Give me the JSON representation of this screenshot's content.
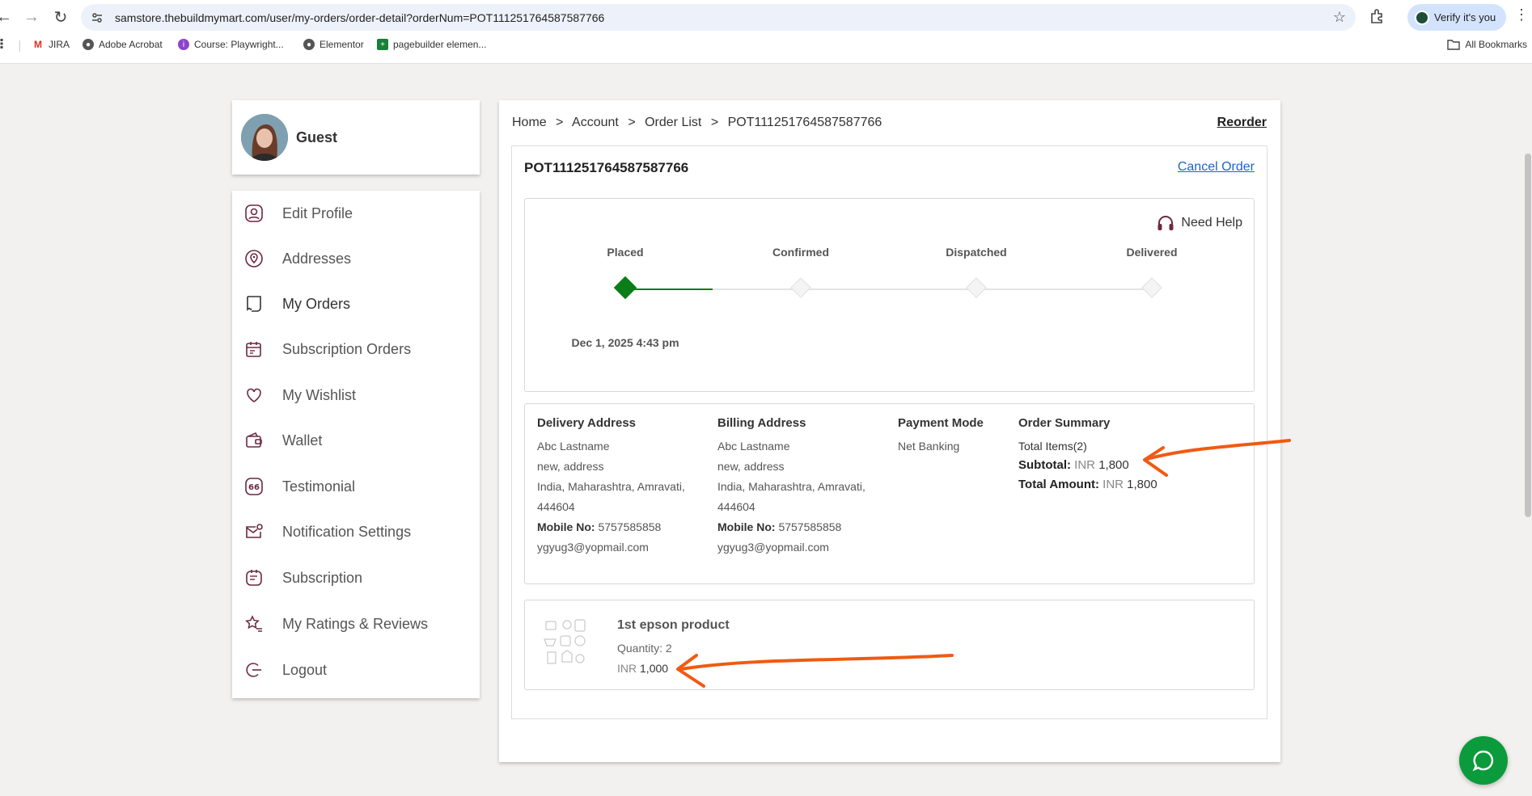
{
  "browser": {
    "url": "samstore.thebuildmymart.com/user/my-orders/order-detail?orderNum=POT111251764587587766",
    "profile_label": "Verify it's you",
    "bookmarks": [
      {
        "label": "JIRA",
        "icon": "gmail-icon"
      },
      {
        "label": "Adobe Acrobat",
        "icon": "globe-icon"
      },
      {
        "label": "Course: Playwright...",
        "icon": "course-icon"
      },
      {
        "label": "Elementor",
        "icon": "globe-icon"
      },
      {
        "label": "pagebuilder elemen...",
        "icon": "sheets-icon"
      }
    ],
    "all_bookmarks": "All Bookmarks"
  },
  "profile": {
    "name": "Guest"
  },
  "menu": [
    {
      "label": "Edit Profile",
      "icon": "user-icon"
    },
    {
      "label": "Addresses",
      "icon": "location-pin-icon"
    },
    {
      "label": "My Orders",
      "icon": "receipt-icon"
    },
    {
      "label": "Subscription Orders",
      "icon": "calendar-icon"
    },
    {
      "label": "My Wishlist",
      "icon": "heart-icon"
    },
    {
      "label": "Wallet",
      "icon": "wallet-icon"
    },
    {
      "label": "Testimonial",
      "icon": "quote-icon"
    },
    {
      "label": "Notification Settings",
      "icon": "mail-settings-icon"
    },
    {
      "label": "Subscription",
      "icon": "subscription-icon"
    },
    {
      "label": "My Ratings & Reviews",
      "icon": "star-list-icon"
    },
    {
      "label": "Logout",
      "icon": "logout-icon"
    }
  ],
  "breadcrumb": [
    "Home",
    "Account",
    "Order List",
    "POT111251764587587766"
  ],
  "breadcrumb_sep": ">",
  "reorder_label": "Reorder",
  "order": {
    "id": "POT111251764587587766",
    "cancel_label": "Cancel Order",
    "need_help": "Need Help",
    "steps": [
      "Placed",
      "Confirmed",
      "Dispatched",
      "Delivered"
    ],
    "completed_steps": 1,
    "placed_date": "Dec 1, 2025 4:43 pm"
  },
  "delivery_address": {
    "title": "Delivery Address",
    "name": "Abc Lastname",
    "line1": "new, address",
    "line2": "India, Maharashtra, Amravati,",
    "zip": "444604",
    "mobile_label": "Mobile No:",
    "mobile": "5757585858",
    "email": "ygyug3@yopmail.com"
  },
  "billing_address": {
    "title": "Billing Address",
    "name": "Abc Lastname",
    "line1": "new, address",
    "line2": "India, Maharashtra, Amravati,",
    "zip": "444604",
    "mobile_label": "Mobile No:",
    "mobile": "5757585858",
    "email": "ygyug3@yopmail.com"
  },
  "payment": {
    "title": "Payment Mode",
    "mode": "Net Banking"
  },
  "summary": {
    "title": "Order Summary",
    "total_items": "Total Items(2)",
    "subtotal_label": "Subtotal:",
    "subtotal_currency": "INR",
    "subtotal_value": "1,800",
    "total_label": "Total Amount:",
    "total_currency": "INR",
    "total_value": "1,800"
  },
  "product": {
    "name": "1st epson product",
    "quantity": "Quantity: 2",
    "currency": "INR",
    "price": "1,000"
  },
  "colors": {
    "accent_green": "#0a7d18",
    "link_blue": "#1a66c9",
    "annotation_orange": "#f05a12",
    "icon_maroon": "#6b2a3f",
    "chat_green": "#0b9b3c"
  }
}
